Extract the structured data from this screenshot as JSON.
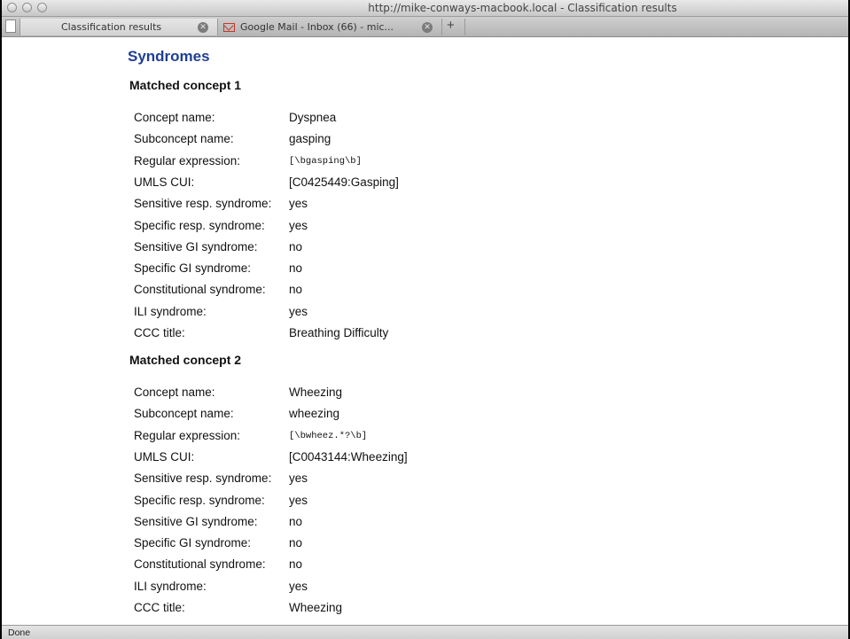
{
  "window": {
    "title": "http://mike-conways-macbook.local - Classification results"
  },
  "tabs": [
    {
      "label": "Classification results"
    },
    {
      "label": "Google Mail - Inbox (66) - mic..."
    }
  ],
  "new_tab_label": "+",
  "page": {
    "heading": "Syndromes",
    "concepts": [
      {
        "title": "Matched concept 1",
        "rows": [
          {
            "key": "Concept name:",
            "value": "Dyspnea"
          },
          {
            "key": "Subconcept name:",
            "value": "gasping"
          },
          {
            "key": "Regular expression:",
            "value": "[\\bgasping\\b]"
          },
          {
            "key": "UMLS CUI:",
            "value": "[C0425449:Gasping]"
          },
          {
            "key": "Sensitive resp. syndrome:",
            "value": "yes"
          },
          {
            "key": "Specific resp. syndrome:",
            "value": "yes"
          },
          {
            "key": "Sensitive GI syndrome:",
            "value": "no"
          },
          {
            "key": "Specific GI syndrome:",
            "value": "no"
          },
          {
            "key": "Constitutional syndrome:",
            "value": "no"
          },
          {
            "key": "ILI syndrome:",
            "value": "yes"
          },
          {
            "key": "CCC title:",
            "value": "Breathing Difficulty"
          }
        ]
      },
      {
        "title": "Matched concept 2",
        "rows": [
          {
            "key": "Concept name:",
            "value": "Wheezing"
          },
          {
            "key": "Subconcept name:",
            "value": "wheezing"
          },
          {
            "key": "Regular expression:",
            "value": "[\\bwheez.*?\\b]"
          },
          {
            "key": "UMLS CUI:",
            "value": "[C0043144:Wheezing]"
          },
          {
            "key": "Sensitive resp. syndrome:",
            "value": "yes"
          },
          {
            "key": "Specific resp. syndrome:",
            "value": "yes"
          },
          {
            "key": "Sensitive GI syndrome:",
            "value": "no"
          },
          {
            "key": "Specific GI syndrome:",
            "value": "no"
          },
          {
            "key": "Constitutional syndrome:",
            "value": "no"
          },
          {
            "key": "ILI syndrome:",
            "value": "yes"
          },
          {
            "key": "CCC title:",
            "value": "Wheezing"
          }
        ]
      }
    ]
  },
  "status_text": "Done"
}
